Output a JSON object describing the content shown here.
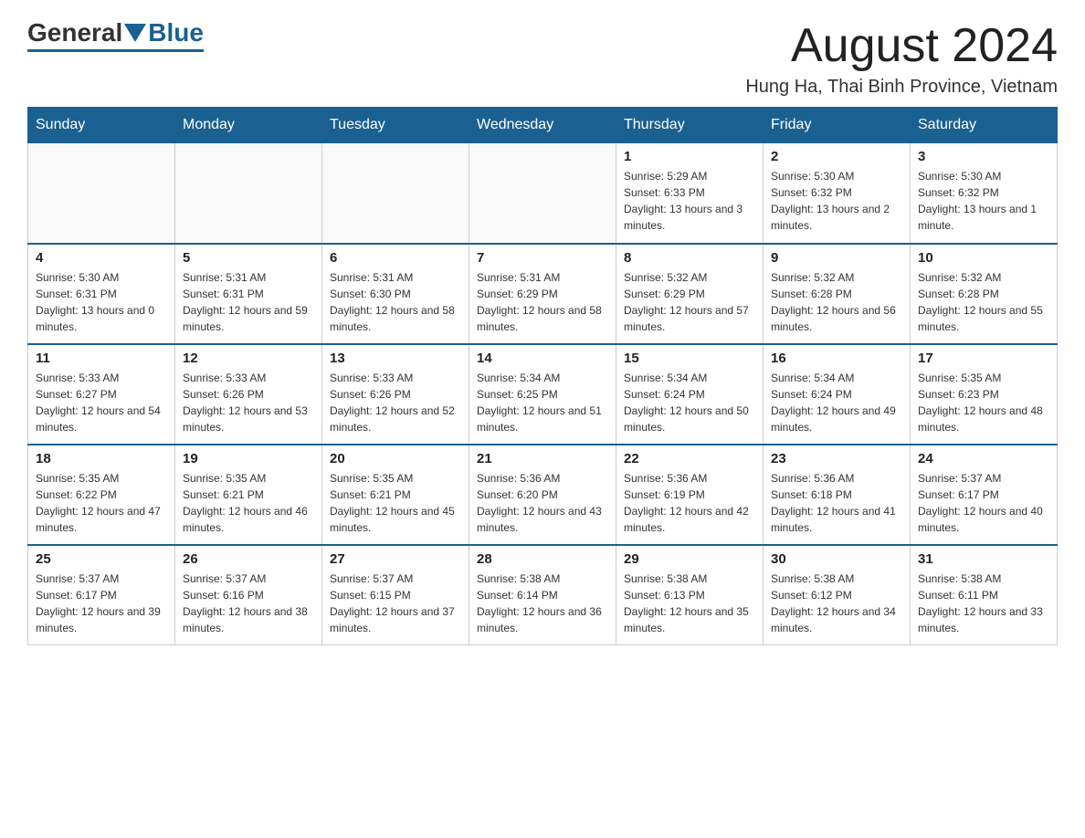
{
  "header": {
    "title": "August 2024",
    "location": "Hung Ha, Thai Binh Province, Vietnam",
    "logo": {
      "general": "General",
      "blue": "Blue"
    }
  },
  "days_of_week": [
    "Sunday",
    "Monday",
    "Tuesday",
    "Wednesday",
    "Thursday",
    "Friday",
    "Saturday"
  ],
  "weeks": [
    [
      {
        "day": "",
        "sunrise": "",
        "sunset": "",
        "daylight": "",
        "empty": true
      },
      {
        "day": "",
        "sunrise": "",
        "sunset": "",
        "daylight": "",
        "empty": true
      },
      {
        "day": "",
        "sunrise": "",
        "sunset": "",
        "daylight": "",
        "empty": true
      },
      {
        "day": "",
        "sunrise": "",
        "sunset": "",
        "daylight": "",
        "empty": true
      },
      {
        "day": "1",
        "sunrise": "Sunrise: 5:29 AM",
        "sunset": "Sunset: 6:33 PM",
        "daylight": "Daylight: 13 hours and 3 minutes.",
        "empty": false
      },
      {
        "day": "2",
        "sunrise": "Sunrise: 5:30 AM",
        "sunset": "Sunset: 6:32 PM",
        "daylight": "Daylight: 13 hours and 2 minutes.",
        "empty": false
      },
      {
        "day": "3",
        "sunrise": "Sunrise: 5:30 AM",
        "sunset": "Sunset: 6:32 PM",
        "daylight": "Daylight: 13 hours and 1 minute.",
        "empty": false
      }
    ],
    [
      {
        "day": "4",
        "sunrise": "Sunrise: 5:30 AM",
        "sunset": "Sunset: 6:31 PM",
        "daylight": "Daylight: 13 hours and 0 minutes.",
        "empty": false
      },
      {
        "day": "5",
        "sunrise": "Sunrise: 5:31 AM",
        "sunset": "Sunset: 6:31 PM",
        "daylight": "Daylight: 12 hours and 59 minutes.",
        "empty": false
      },
      {
        "day": "6",
        "sunrise": "Sunrise: 5:31 AM",
        "sunset": "Sunset: 6:30 PM",
        "daylight": "Daylight: 12 hours and 58 minutes.",
        "empty": false
      },
      {
        "day": "7",
        "sunrise": "Sunrise: 5:31 AM",
        "sunset": "Sunset: 6:29 PM",
        "daylight": "Daylight: 12 hours and 58 minutes.",
        "empty": false
      },
      {
        "day": "8",
        "sunrise": "Sunrise: 5:32 AM",
        "sunset": "Sunset: 6:29 PM",
        "daylight": "Daylight: 12 hours and 57 minutes.",
        "empty": false
      },
      {
        "day": "9",
        "sunrise": "Sunrise: 5:32 AM",
        "sunset": "Sunset: 6:28 PM",
        "daylight": "Daylight: 12 hours and 56 minutes.",
        "empty": false
      },
      {
        "day": "10",
        "sunrise": "Sunrise: 5:32 AM",
        "sunset": "Sunset: 6:28 PM",
        "daylight": "Daylight: 12 hours and 55 minutes.",
        "empty": false
      }
    ],
    [
      {
        "day": "11",
        "sunrise": "Sunrise: 5:33 AM",
        "sunset": "Sunset: 6:27 PM",
        "daylight": "Daylight: 12 hours and 54 minutes.",
        "empty": false
      },
      {
        "day": "12",
        "sunrise": "Sunrise: 5:33 AM",
        "sunset": "Sunset: 6:26 PM",
        "daylight": "Daylight: 12 hours and 53 minutes.",
        "empty": false
      },
      {
        "day": "13",
        "sunrise": "Sunrise: 5:33 AM",
        "sunset": "Sunset: 6:26 PM",
        "daylight": "Daylight: 12 hours and 52 minutes.",
        "empty": false
      },
      {
        "day": "14",
        "sunrise": "Sunrise: 5:34 AM",
        "sunset": "Sunset: 6:25 PM",
        "daylight": "Daylight: 12 hours and 51 minutes.",
        "empty": false
      },
      {
        "day": "15",
        "sunrise": "Sunrise: 5:34 AM",
        "sunset": "Sunset: 6:24 PM",
        "daylight": "Daylight: 12 hours and 50 minutes.",
        "empty": false
      },
      {
        "day": "16",
        "sunrise": "Sunrise: 5:34 AM",
        "sunset": "Sunset: 6:24 PM",
        "daylight": "Daylight: 12 hours and 49 minutes.",
        "empty": false
      },
      {
        "day": "17",
        "sunrise": "Sunrise: 5:35 AM",
        "sunset": "Sunset: 6:23 PM",
        "daylight": "Daylight: 12 hours and 48 minutes.",
        "empty": false
      }
    ],
    [
      {
        "day": "18",
        "sunrise": "Sunrise: 5:35 AM",
        "sunset": "Sunset: 6:22 PM",
        "daylight": "Daylight: 12 hours and 47 minutes.",
        "empty": false
      },
      {
        "day": "19",
        "sunrise": "Sunrise: 5:35 AM",
        "sunset": "Sunset: 6:21 PM",
        "daylight": "Daylight: 12 hours and 46 minutes.",
        "empty": false
      },
      {
        "day": "20",
        "sunrise": "Sunrise: 5:35 AM",
        "sunset": "Sunset: 6:21 PM",
        "daylight": "Daylight: 12 hours and 45 minutes.",
        "empty": false
      },
      {
        "day": "21",
        "sunrise": "Sunrise: 5:36 AM",
        "sunset": "Sunset: 6:20 PM",
        "daylight": "Daylight: 12 hours and 43 minutes.",
        "empty": false
      },
      {
        "day": "22",
        "sunrise": "Sunrise: 5:36 AM",
        "sunset": "Sunset: 6:19 PM",
        "daylight": "Daylight: 12 hours and 42 minutes.",
        "empty": false
      },
      {
        "day": "23",
        "sunrise": "Sunrise: 5:36 AM",
        "sunset": "Sunset: 6:18 PM",
        "daylight": "Daylight: 12 hours and 41 minutes.",
        "empty": false
      },
      {
        "day": "24",
        "sunrise": "Sunrise: 5:37 AM",
        "sunset": "Sunset: 6:17 PM",
        "daylight": "Daylight: 12 hours and 40 minutes.",
        "empty": false
      }
    ],
    [
      {
        "day": "25",
        "sunrise": "Sunrise: 5:37 AM",
        "sunset": "Sunset: 6:17 PM",
        "daylight": "Daylight: 12 hours and 39 minutes.",
        "empty": false
      },
      {
        "day": "26",
        "sunrise": "Sunrise: 5:37 AM",
        "sunset": "Sunset: 6:16 PM",
        "daylight": "Daylight: 12 hours and 38 minutes.",
        "empty": false
      },
      {
        "day": "27",
        "sunrise": "Sunrise: 5:37 AM",
        "sunset": "Sunset: 6:15 PM",
        "daylight": "Daylight: 12 hours and 37 minutes.",
        "empty": false
      },
      {
        "day": "28",
        "sunrise": "Sunrise: 5:38 AM",
        "sunset": "Sunset: 6:14 PM",
        "daylight": "Daylight: 12 hours and 36 minutes.",
        "empty": false
      },
      {
        "day": "29",
        "sunrise": "Sunrise: 5:38 AM",
        "sunset": "Sunset: 6:13 PM",
        "daylight": "Daylight: 12 hours and 35 minutes.",
        "empty": false
      },
      {
        "day": "30",
        "sunrise": "Sunrise: 5:38 AM",
        "sunset": "Sunset: 6:12 PM",
        "daylight": "Daylight: 12 hours and 34 minutes.",
        "empty": false
      },
      {
        "day": "31",
        "sunrise": "Sunrise: 5:38 AM",
        "sunset": "Sunset: 6:11 PM",
        "daylight": "Daylight: 12 hours and 33 minutes.",
        "empty": false
      }
    ]
  ]
}
